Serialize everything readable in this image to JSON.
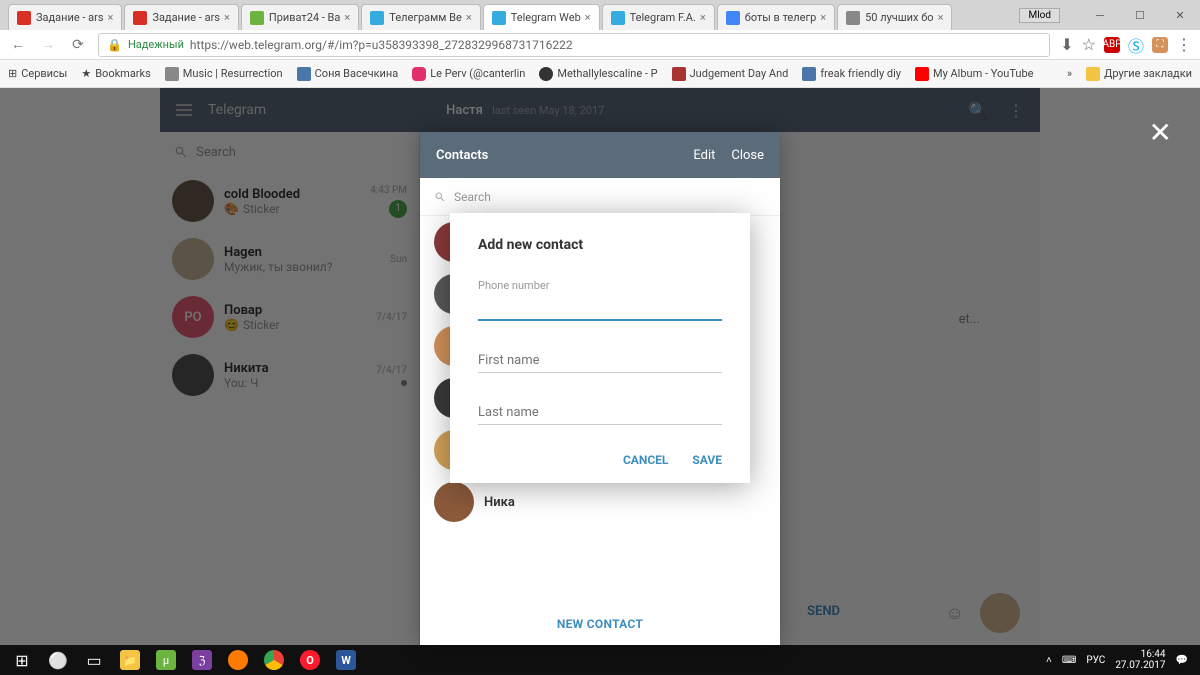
{
  "window": {
    "user_badge": "Mlod"
  },
  "tabs": [
    {
      "title": "Задание - ars",
      "favicon": "#d93025"
    },
    {
      "title": "Задание - ars",
      "favicon": "#d93025"
    },
    {
      "title": "Приват24 - Ва",
      "favicon": "#6db33f"
    },
    {
      "title": "Телеграмм Ве",
      "favicon": "#35ace0"
    },
    {
      "title": "Telegram Web",
      "favicon": "#35ace0",
      "active": true
    },
    {
      "title": "Telegram F.A.",
      "favicon": "#35ace0"
    },
    {
      "title": "боты в телегр",
      "favicon": "#4285f4"
    },
    {
      "title": "50 лучших бо",
      "favicon": "#888"
    }
  ],
  "addr": {
    "secure_label": "Надежный",
    "url": "https://web.telegram.org/#/im?p=u358393398_2728329968731716222"
  },
  "bookmarks": {
    "apps": "Сервисы",
    "items": [
      {
        "label": "Bookmarks",
        "color": "#444"
      },
      {
        "label": "Music | Resurrection",
        "color": "#888"
      },
      {
        "label": "Соня Васечкина",
        "color": "#4a76a8"
      },
      {
        "label": "Le Perv (@canterlin",
        "color": "#e1306c"
      },
      {
        "label": "Methallylescaline - P",
        "color": "#333"
      },
      {
        "label": "Judgement Day And",
        "color": "#a33"
      },
      {
        "label": "freak friendly diy",
        "color": "#4a76a8"
      },
      {
        "label": "My Album - YouTube",
        "color": "#ff0000"
      }
    ],
    "other": "Другие закладки"
  },
  "telegram": {
    "title": "Telegram",
    "chat_name": "Настя",
    "chat_status": "last seen May 18, 2017",
    "search_placeholder": "Search",
    "preview_placeholder": "et...",
    "chats": [
      {
        "name": "cold Blooded",
        "preview": "Sticker",
        "time": "4:43 PM",
        "badge": "1",
        "avatar_bg": "#6b5b4a",
        "sticker": true
      },
      {
        "name": "Hagen",
        "preview": "Мужик, ты звонил?",
        "time": "Sun",
        "avatar_bg": "#c9b89a"
      },
      {
        "name": "Повар",
        "preview": "Sticker",
        "time": "7/4/17",
        "avatar_bg": "#e85d75",
        "avatar_text": "PO",
        "sticker": true
      },
      {
        "name": "Никита",
        "preview": "You: Ч",
        "time": "7/4/17",
        "avatar_bg": "#555",
        "badge_dot": true
      }
    ],
    "send_label": "SEND"
  },
  "contacts_panel": {
    "title": "Contacts",
    "edit": "Edit",
    "close": "Close",
    "search_placeholder": "Search",
    "visible_contacts": [
      {
        "avatar_bg": "#8b3a3a"
      },
      {
        "avatar_bg": "#5a5a5a"
      },
      {
        "avatar_bg": "#d4935a"
      },
      {
        "avatar_bg": "#3a3a3a"
      },
      {
        "avatar_bg": "#d4a35a"
      },
      {
        "avatar_bg": "#8b5a3a"
      }
    ],
    "last_contact_name": "Ника",
    "new_contact": "NEW CONTACT"
  },
  "modal": {
    "title": "Add new contact",
    "phone_label": "Phone number",
    "first_name_label": "First name",
    "last_name_label": "Last name",
    "cancel": "CANCEL",
    "save": "SAVE"
  },
  "taskbar": {
    "lang": "РУС",
    "time": "16:44",
    "date": "27.07.2017"
  }
}
